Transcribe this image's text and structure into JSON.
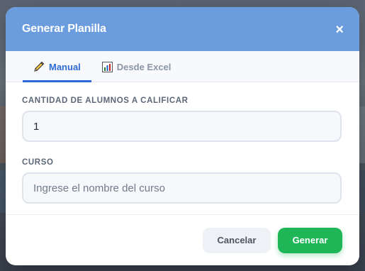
{
  "modal": {
    "title": "Generar Planilla",
    "close_symbol": "×"
  },
  "tabs": [
    {
      "label": "Manual",
      "icon": "pencil-icon",
      "active": true
    },
    {
      "label": "Desde Excel",
      "icon": "bar-chart-icon",
      "active": false
    }
  ],
  "fields": {
    "cantidad": {
      "label": "CANTIDAD DE ALUMNOS A CALIFICAR",
      "value": "1",
      "placeholder": ""
    },
    "curso": {
      "label": "CURSO",
      "value": "",
      "placeholder": "Ingrese el nombre del curso"
    }
  },
  "footer": {
    "cancel_label": "Cancelar",
    "submit_label": "Generar"
  },
  "colors": {
    "header": "#6a9cde",
    "active_tab": "#2d6bd6",
    "primary_button": "#1fb657"
  }
}
